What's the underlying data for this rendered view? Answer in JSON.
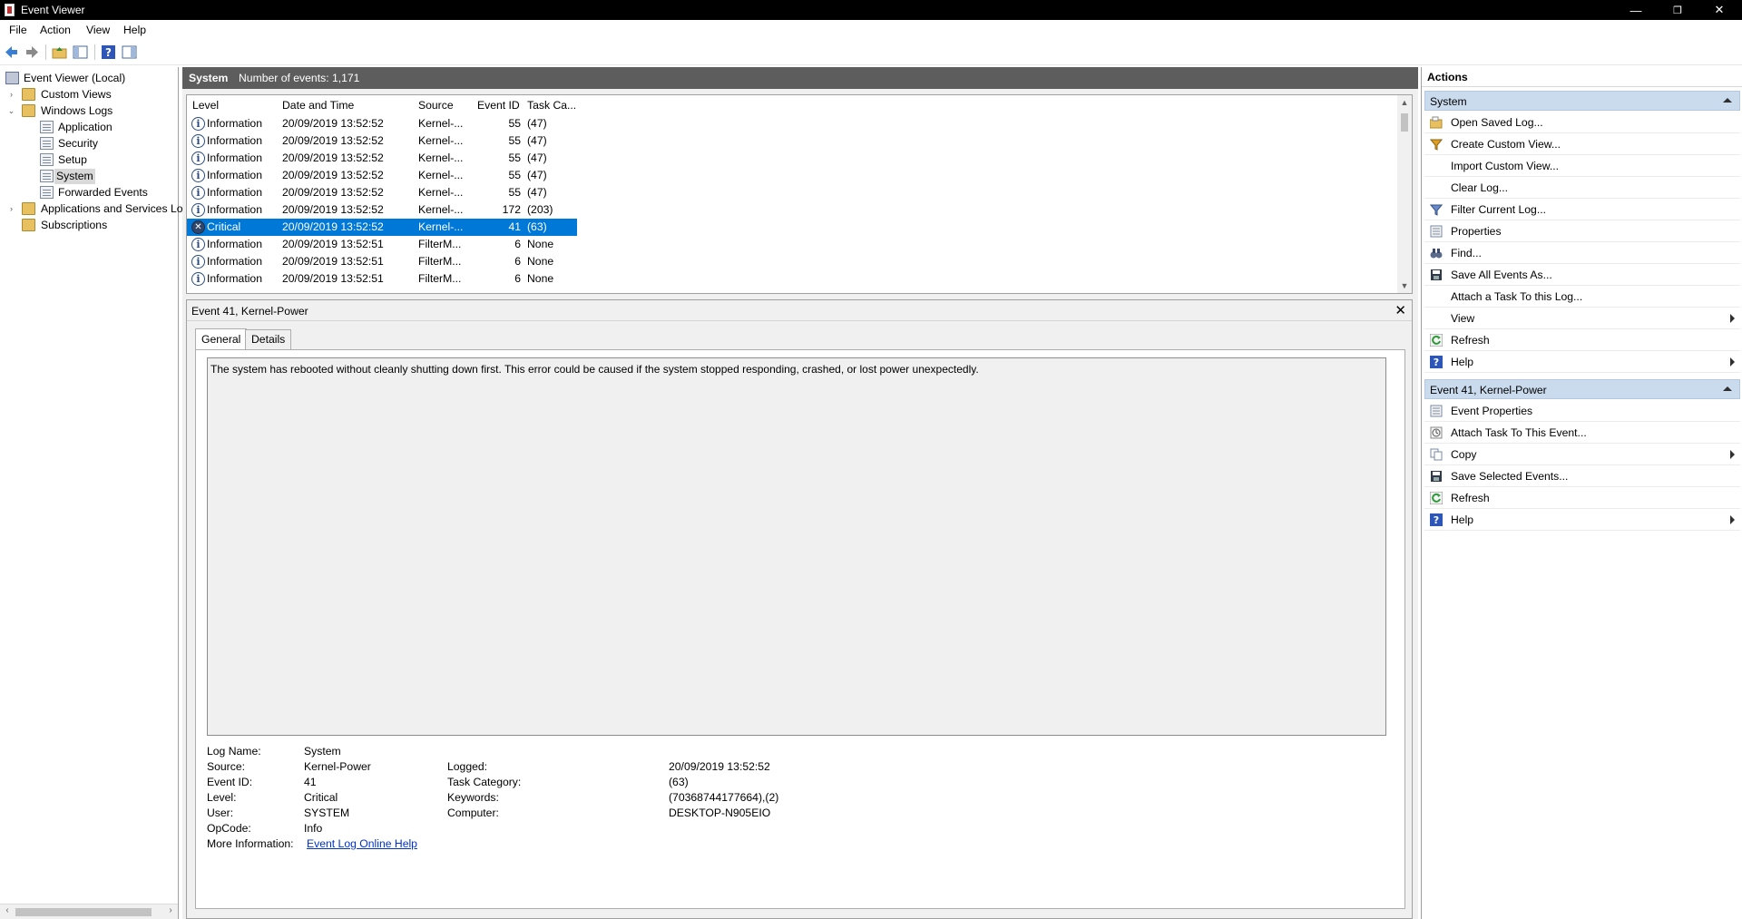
{
  "window": {
    "title": "Event Viewer",
    "minimize": "—",
    "restore": "❐",
    "close": "✕"
  },
  "menu": [
    "File",
    "Action",
    "View",
    "Help"
  ],
  "tree": {
    "root": "Event Viewer (Local)",
    "custom_views": "Custom Views",
    "windows_logs": "Windows Logs",
    "logs": [
      "Application",
      "Security",
      "Setup",
      "System",
      "Forwarded Events"
    ],
    "apps_services": "Applications and Services Lo",
    "subscriptions": "Subscriptions"
  },
  "center": {
    "log_name": "System",
    "count_label": "Number of events: 1,171",
    "columns": [
      "Level",
      "Date and Time",
      "Source",
      "Event ID",
      "Task Ca..."
    ],
    "rows": [
      {
        "level": "Information",
        "datetime": "20/09/2019 13:52:52",
        "source": "Kernel-...",
        "event_id": "55",
        "task": "(47)"
      },
      {
        "level": "Information",
        "datetime": "20/09/2019 13:52:52",
        "source": "Kernel-...",
        "event_id": "55",
        "task": "(47)"
      },
      {
        "level": "Information",
        "datetime": "20/09/2019 13:52:52",
        "source": "Kernel-...",
        "event_id": "55",
        "task": "(47)"
      },
      {
        "level": "Information",
        "datetime": "20/09/2019 13:52:52",
        "source": "Kernel-...",
        "event_id": "55",
        "task": "(47)"
      },
      {
        "level": "Information",
        "datetime": "20/09/2019 13:52:52",
        "source": "Kernel-...",
        "event_id": "55",
        "task": "(47)"
      },
      {
        "level": "Information",
        "datetime": "20/09/2019 13:52:52",
        "source": "Kernel-...",
        "event_id": "172",
        "task": "(203)"
      },
      {
        "level": "Critical",
        "datetime": "20/09/2019 13:52:52",
        "source": "Kernel-...",
        "event_id": "41",
        "task": "(63)"
      },
      {
        "level": "Information",
        "datetime": "20/09/2019 13:52:51",
        "source": "FilterM...",
        "event_id": "6",
        "task": "None"
      },
      {
        "level": "Information",
        "datetime": "20/09/2019 13:52:51",
        "source": "FilterM...",
        "event_id": "6",
        "task": "None"
      },
      {
        "level": "Information",
        "datetime": "20/09/2019 13:52:51",
        "source": "FilterM...",
        "event_id": "6",
        "task": "None"
      }
    ]
  },
  "detail": {
    "title": "Event 41, Kernel-Power",
    "close": "✕",
    "tabs": [
      "General",
      "Details"
    ],
    "description": "The system has rebooted without cleanly shutting down first. This error could be caused if the system stopped responding, crashed, or lost power unexpectedly.",
    "log_name_label": "Log Name:",
    "log_name": "System",
    "source_label": "Source:",
    "source": "Kernel-Power",
    "logged_label": "Logged:",
    "logged": "20/09/2019 13:52:52",
    "event_id_label": "Event ID:",
    "event_id": "41",
    "task_label": "Task Category:",
    "task": "(63)",
    "level_label": "Level:",
    "level": "Critical",
    "keywords_label": "Keywords:",
    "keywords": "(70368744177664),(2)",
    "user_label": "User:",
    "user": "SYSTEM",
    "computer_label": "Computer:",
    "computer": "DESKTOP-N905EIO",
    "opcode_label": "OpCode:",
    "opcode": "Info",
    "more_info_label": "More Information:",
    "more_info_link": "Event Log Online Help"
  },
  "actions": {
    "title": "Actions",
    "section1": "System",
    "items1": [
      {
        "label": "Open Saved Log...",
        "icon": "open-folder-icon"
      },
      {
        "label": "Create Custom View...",
        "icon": "filter-create-icon"
      },
      {
        "label": "Import Custom View...",
        "icon": ""
      },
      {
        "label": "Clear Log...",
        "icon": ""
      },
      {
        "label": "Filter Current Log...",
        "icon": "filter-icon"
      },
      {
        "label": "Properties",
        "icon": "properties-icon"
      },
      {
        "label": "Find...",
        "icon": "binoculars-icon"
      },
      {
        "label": "Save All Events As...",
        "icon": "save-icon"
      },
      {
        "label": "Attach a Task To this Log...",
        "icon": ""
      },
      {
        "label": "View",
        "icon": "",
        "submenu": true
      },
      {
        "label": "Refresh",
        "icon": "refresh-icon"
      },
      {
        "label": "Help",
        "icon": "help-icon",
        "submenu": true
      }
    ],
    "section2": "Event 41, Kernel-Power",
    "items2": [
      {
        "label": "Event Properties",
        "icon": "properties-icon"
      },
      {
        "label": "Attach Task To This Event...",
        "icon": "task-icon"
      },
      {
        "label": "Copy",
        "icon": "copy-icon",
        "submenu": true
      },
      {
        "label": "Save Selected Events...",
        "icon": "save-icon"
      },
      {
        "label": "Refresh",
        "icon": "refresh-icon"
      },
      {
        "label": "Help",
        "icon": "help-icon",
        "submenu": true
      }
    ]
  }
}
